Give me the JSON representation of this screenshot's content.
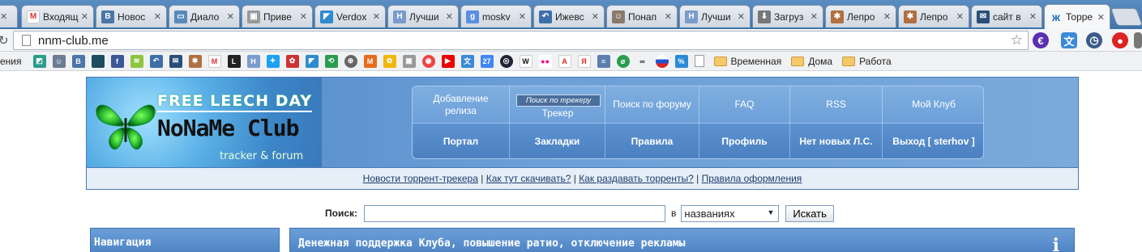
{
  "browser": {
    "tabs": [
      {
        "title": "",
        "icon": "x"
      },
      {
        "title": "Входящ",
        "icon": "gmail-icon"
      },
      {
        "title": "Новос",
        "icon": "vk-icon"
      },
      {
        "title": "Диало",
        "icon": "chat-icon"
      },
      {
        "title": "Приве",
        "icon": "tv-icon"
      },
      {
        "title": "Verdox",
        "icon": "verdox-icon"
      },
      {
        "title": "Лучши",
        "icon": "h-icon"
      },
      {
        "title": "moskv",
        "icon": "google-icon"
      },
      {
        "title": "Ижевс",
        "icon": "back-arrow-icon"
      },
      {
        "title": "Понап",
        "icon": "person-icon"
      },
      {
        "title": "Лучши",
        "icon": "h-icon"
      },
      {
        "title": "Загруз",
        "icon": "download-icon"
      },
      {
        "title": "Лепро",
        "icon": "lepra-icon"
      },
      {
        "title": "Лепро",
        "icon": "lepra-icon"
      },
      {
        "title": "сайт в",
        "icon": "mail-icon"
      },
      {
        "title": "Торре",
        "icon": "butterfly-icon"
      }
    ],
    "url": "nnm-club.me",
    "bookmarks_first": "ения",
    "bookmark_folders": [
      "Временная",
      "Дома",
      "Работа"
    ]
  },
  "header": {
    "logo_top": "FREE LEECH DAY",
    "logo_main": "NoNaMe Club",
    "logo_tagline": "tracker & forum",
    "nav": {
      "add_release": "Добавление релиза",
      "tracker_search": "Поиск по трекеру",
      "tracker": "Трекер",
      "forum_search": "Поиск по форуму",
      "faq": "FAQ",
      "rss": "RSS",
      "my_club": "Мой Клуб",
      "portal": "Портал",
      "bookmarks": "Закладки",
      "rules": "Правила",
      "profile": "Профиль",
      "pm": "Нет новых Л.С.",
      "logout": "Выход [ sterhov ]"
    }
  },
  "subnav": {
    "links": [
      "Новости торрент-трекера",
      "Как тут скачивать?",
      "Как раздавать торренты?",
      "Правила оформления"
    ],
    "separator": "|"
  },
  "search": {
    "label": "Поиск:",
    "value": "",
    "in_label": "в",
    "scope_selected": "названиях",
    "button": "Искать"
  },
  "sidebar": {
    "title": "Навигация"
  },
  "main": {
    "notice_title": "Денежная поддержка Клуба, повышение ратио, отключение рекламы"
  }
}
